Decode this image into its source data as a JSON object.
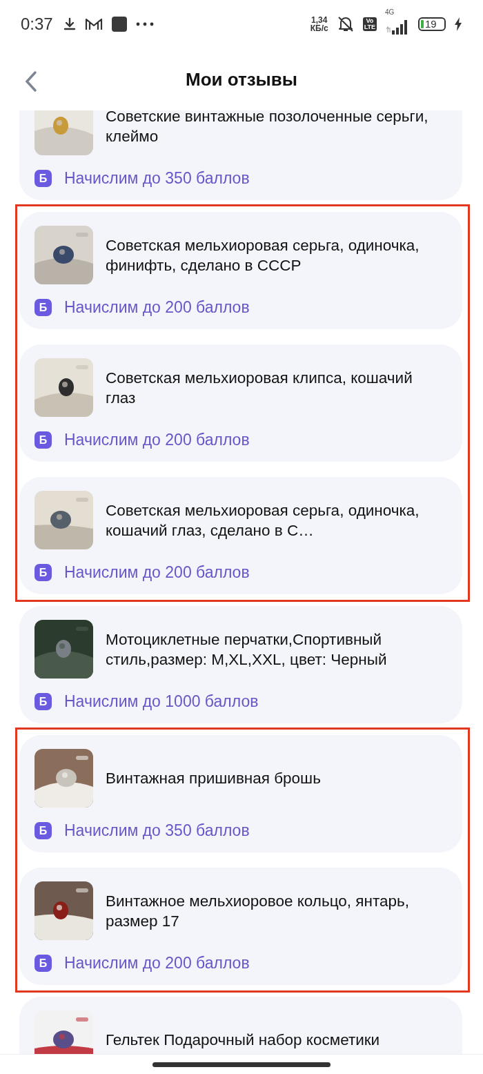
{
  "status_bar": {
    "time": "0:37",
    "speed_value": "1,34",
    "speed_unit": "КБ/с",
    "volte_top": "Vo",
    "volte_bottom": "LTE",
    "network": "4G",
    "battery": "19"
  },
  "header": {
    "title": "Мои отзывы"
  },
  "groups": [
    {
      "outlined": false,
      "items": [
        {
          "title": "Советские винтажные позолоченные серьги, клеймо",
          "badge": "Б",
          "bonus": "Начислим до 350 баллов"
        }
      ]
    },
    {
      "outlined": true,
      "items": [
        {
          "title": "Советская мельхиоровая серьга, одиночка, финифть, сделано в СССР",
          "badge": "Б",
          "bonus": "Начислим до 200 баллов"
        },
        {
          "title": "Советская мельхиоровая клипса, кошачий глаз",
          "badge": "Б",
          "bonus": "Начислим до 200 баллов"
        },
        {
          "title": "Советская мельхиоровая серьга, одиночка, кошачий глаз, сделано в С…",
          "badge": "Б",
          "bonus": "Начислим до 200 баллов"
        }
      ]
    },
    {
      "outlined": false,
      "items": [
        {
          "title": "Мотоциклетные перчатки,Спортивный стиль,размер: M,XL,XXL, цвет: Черный",
          "badge": "Б",
          "bonus": "Начислим до 1000 баллов"
        }
      ]
    },
    {
      "outlined": true,
      "items": [
        {
          "title": "Винтажная пришивная брошь",
          "badge": "Б",
          "bonus": "Начислим до 350 баллов"
        },
        {
          "title": "Винтажное мельхиоровое кольцо, янтарь, размер 17",
          "badge": "Б",
          "bonus": "Начислим до 200 баллов"
        }
      ]
    },
    {
      "outlined": false,
      "items": [
        {
          "title": "Гельтек Подарочный набор косметики"
        }
      ]
    }
  ]
}
